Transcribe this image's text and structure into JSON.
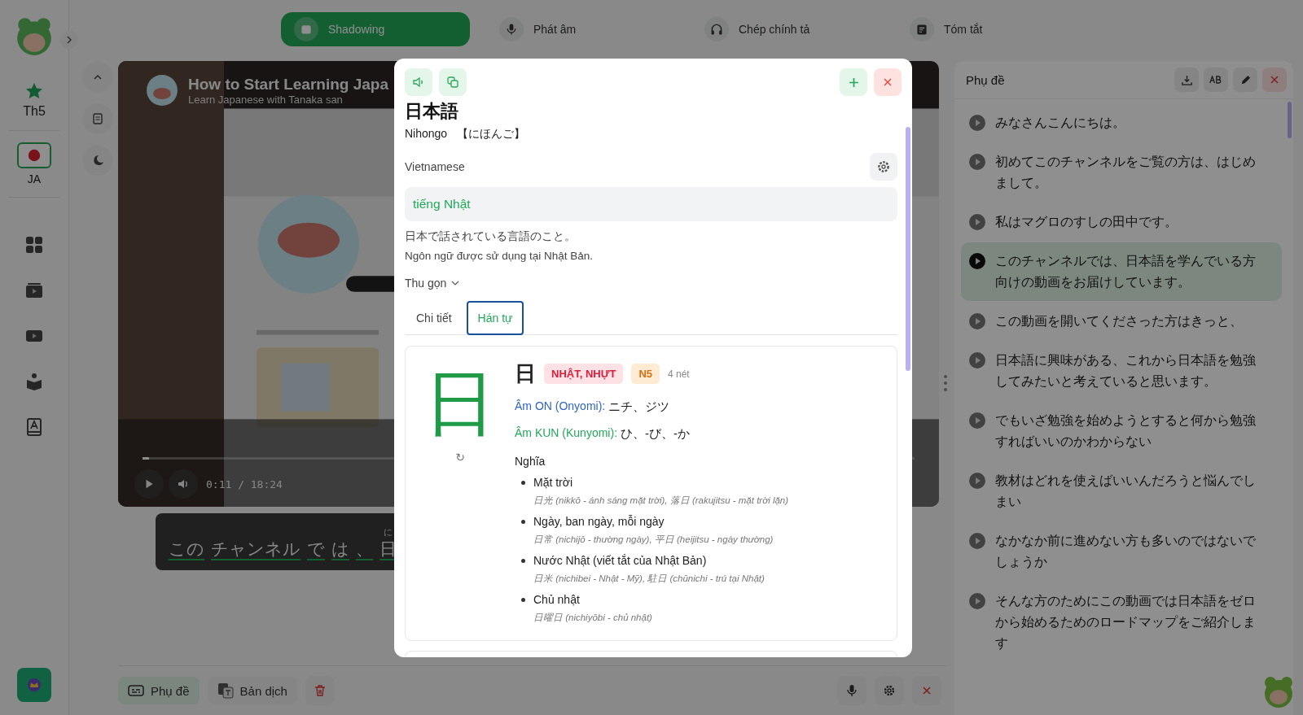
{
  "sidebar": {
    "level_label": "Th5",
    "language": {
      "label": "JA",
      "selected": true
    }
  },
  "mode_tabs": [
    {
      "label": "Shadowing",
      "selected": true
    },
    {
      "label": "Phát âm",
      "selected": false
    },
    {
      "label": "Chép chính tả",
      "selected": false
    },
    {
      "label": "Tóm tắt",
      "selected": false
    }
  ],
  "video": {
    "title": "How to Start Learning Japa",
    "channel": "Learn Japanese with Tanaka san",
    "time": "0:11 / 18:24",
    "level": 0.005
  },
  "subtitle_line": {
    "tokens": [
      {
        "text": "この"
      },
      {
        "text": "チャンネル"
      },
      {
        "text": "で"
      },
      {
        "text": "は"
      },
      {
        "text": "、"
      },
      {
        "text": "日",
        "ruby": "に"
      }
    ]
  },
  "bottom_bar": {
    "buttons": [
      {
        "label": "Phụ đề",
        "selected": true
      },
      {
        "label": "Bản dịch",
        "selected": false
      }
    ]
  },
  "subtitle_panel": {
    "title": "Phụ đề",
    "lines": [
      {
        "text": "みなさんこんにちは。",
        "selected": false
      },
      {
        "text": "初めてこのチャンネルをご覧の方は、はじめまして。",
        "selected": false
      },
      {
        "text": "私はマグロのすしの田中です。",
        "selected": false
      },
      {
        "text": "このチャンネルでは、日本語を学んでいる方向けの動画をお届けしています。",
        "selected": true
      },
      {
        "text": "この動画を開いてくださった方はきっと、",
        "selected": false
      },
      {
        "text": "日本語に興味がある、これから日本語を勉強してみたいと考えていると思います。",
        "selected": false
      },
      {
        "text": "でもいざ勉強を始めようとすると何から勉強すればいいのかわからない",
        "selected": false
      },
      {
        "text": "教材はどれを使えばいいんだろうと悩んでしまい",
        "selected": false
      },
      {
        "text": "なかなか前に進めない方も多いのではないでしょうか",
        "selected": false
      },
      {
        "text": "そんな方のためにこの動画では日本語をゼロから始めるためのロードマップをご紹介します",
        "selected": false
      }
    ]
  },
  "dialog": {
    "word": "日本語",
    "romaji": "Nihongo",
    "kana": "【にほんご】",
    "language": "Vietnamese",
    "translation": "tiếng Nhật",
    "definition_ja": "日本で話されている言語のこと。",
    "definition_vi": "Ngôn ngữ được sử dụng tại Nhật Bản.",
    "collapse": "Thu gọn",
    "tabs": [
      {
        "label": "Chi tiết",
        "selected": false
      },
      {
        "label": "Hán tự",
        "selected": true
      }
    ],
    "kanji": {
      "character": "日",
      "stroke_char": "日",
      "replay": "↻",
      "reading_name": "NHẬT, NHỰT",
      "level": "N5",
      "strokes": "4 nét",
      "onyomi_label": "Âm ON (Onyomi):",
      "onyomi": "ニチ、ジツ",
      "kunyomi_label": "Âm KUN (Kunyomi):",
      "kunyomi": "ひ、-び、-か",
      "meaning_title": "Nghĩa",
      "meanings": [
        {
          "text": "Mặt trời",
          "example": "日光 (nikkō - ánh sáng mặt trời), 落日 (rakujitsu - mặt trời lặn)"
        },
        {
          "text": "Ngày, ban ngày, mỗi ngày",
          "example": "日常 (nichijō - thường ngày), 平日 (heijitsu - ngày thường)"
        },
        {
          "text": "Nước Nhật (viết tắt của Nhật Bản)",
          "example": "日米 (nichibei - Nhật - Mỹ), 駐日 (chūnichi - trú tại Nhật)"
        },
        {
          "text": "Chủ nhật",
          "example": "日曜日 (nichiyōbi - chủ nhật)"
        }
      ]
    }
  }
}
